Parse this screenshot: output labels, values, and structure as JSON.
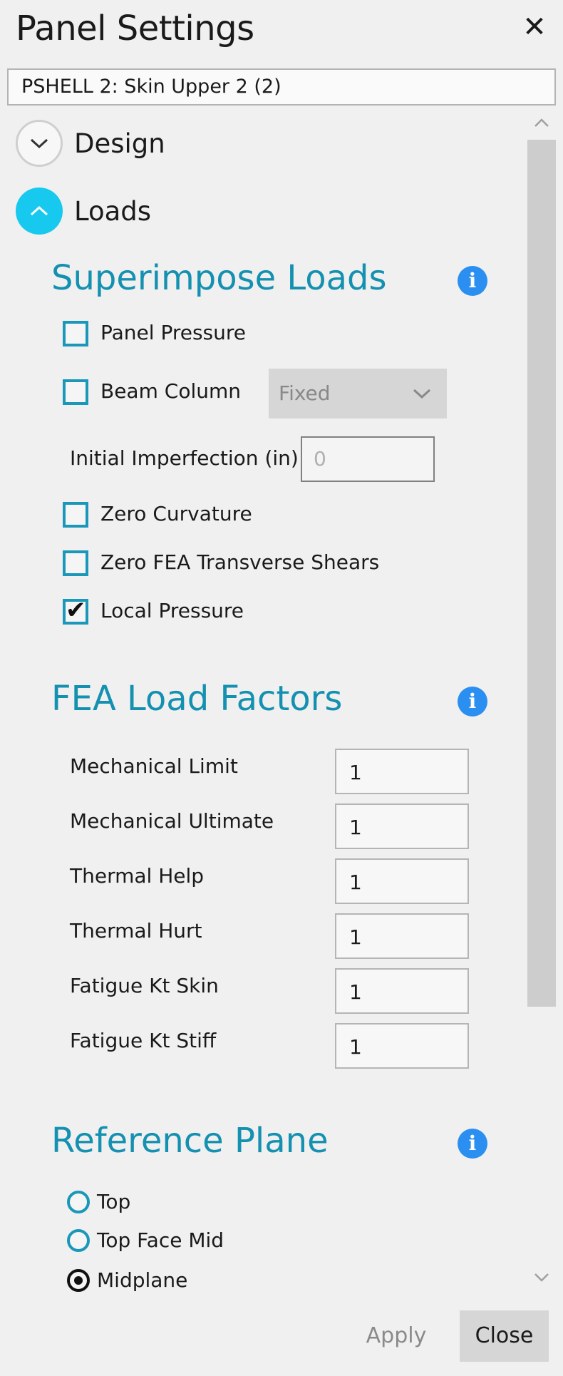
{
  "header": {
    "title": "Panel Settings",
    "close_glyph": "✕",
    "selected_property": "PSHELL 2: Skin Upper 2 (2)"
  },
  "design": {
    "label": "Design",
    "expanded": false
  },
  "loads": {
    "label": "Loads",
    "expanded": true
  },
  "superimpose": {
    "title": "Superimpose Loads",
    "panel_pressure": {
      "label": "Panel Pressure",
      "checked": false
    },
    "beam_column": {
      "label": "Beam Column",
      "checked": false
    },
    "beam_column_mode": {
      "value": "Fixed"
    },
    "initial_imperfection": {
      "label": "Initial Imperfection (in)",
      "value": "0"
    },
    "zero_curvature": {
      "label": "Zero Curvature",
      "checked": false
    },
    "zero_fea_shears": {
      "label": "Zero FEA Transverse Shears",
      "checked": false
    },
    "local_pressure": {
      "label": "Local Pressure",
      "checked": true
    }
  },
  "fea_factors": {
    "title": "FEA Load Factors",
    "rows": [
      {
        "label": "Mechanical Limit",
        "value": "1"
      },
      {
        "label": "Mechanical Ultimate",
        "value": "1"
      },
      {
        "label": "Thermal Help",
        "value": "1"
      },
      {
        "label": "Thermal Hurt",
        "value": "1"
      },
      {
        "label": "Fatigue Kt Skin",
        "value": "1"
      },
      {
        "label": "Fatigue Kt Stiff",
        "value": "1"
      }
    ]
  },
  "reference_plane": {
    "title": "Reference Plane",
    "options": [
      {
        "label": "Top",
        "selected": false
      },
      {
        "label": "Top Face Mid",
        "selected": false
      },
      {
        "label": "Midplane",
        "selected": true
      }
    ]
  },
  "footer": {
    "apply_label": "Apply",
    "close_label": "Close"
  },
  "icons": {
    "info": "i",
    "check": "✔"
  },
  "colors": {
    "accent": "#1490b0",
    "expander_active": "#17c9ee",
    "info": "#2a8ff0"
  }
}
